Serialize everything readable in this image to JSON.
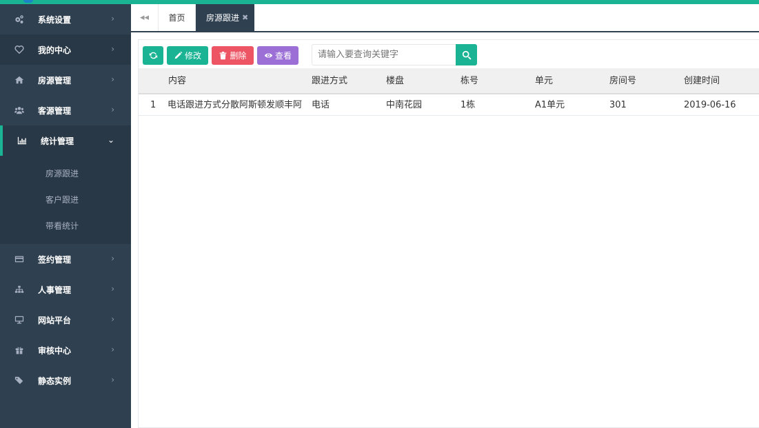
{
  "sidebar": {
    "items": [
      {
        "label": "系统设置",
        "icon": "gears-icon"
      },
      {
        "label": "我的中心",
        "icon": "heart-icon"
      },
      {
        "label": "房源管理",
        "icon": "home-icon"
      },
      {
        "label": "客源管理",
        "icon": "users-icon"
      },
      {
        "label": "统计管理",
        "icon": "bar-chart-icon"
      },
      {
        "label": "签约管理",
        "icon": "credit-card-icon"
      },
      {
        "label": "人事管理",
        "icon": "sitemap-icon"
      },
      {
        "label": "网站平台",
        "icon": "desktop-icon"
      },
      {
        "label": "审核中心",
        "icon": "gift-icon"
      },
      {
        "label": "静态实例",
        "icon": "tags-icon"
      }
    ],
    "submenu": [
      "房源跟进",
      "客户跟进",
      "带看统计"
    ]
  },
  "tabs": {
    "home": "首页",
    "active": "房源跟进",
    "close": "✖"
  },
  "toolbar": {
    "edit": "修改",
    "delete": "删除",
    "view": "查看"
  },
  "search": {
    "placeholder": "请输入要查询关键字"
  },
  "table": {
    "headers": [
      "内容",
      "跟进方式",
      "楼盘",
      "栋号",
      "单元",
      "房间号",
      "创建时间"
    ],
    "rows": [
      {
        "index": "1",
        "content": "电话跟进方式分散阿斯顿发顺丰阿",
        "method": "电话",
        "estate": "中南花园",
        "building": "1栋",
        "unit": "A1单元",
        "room": "301",
        "created": "2019-06-16"
      }
    ]
  },
  "colors": {
    "primary": "#1ab394",
    "sidebar": "#2f4050",
    "danger": "#ed5565",
    "purple": "#9b6fd6"
  }
}
